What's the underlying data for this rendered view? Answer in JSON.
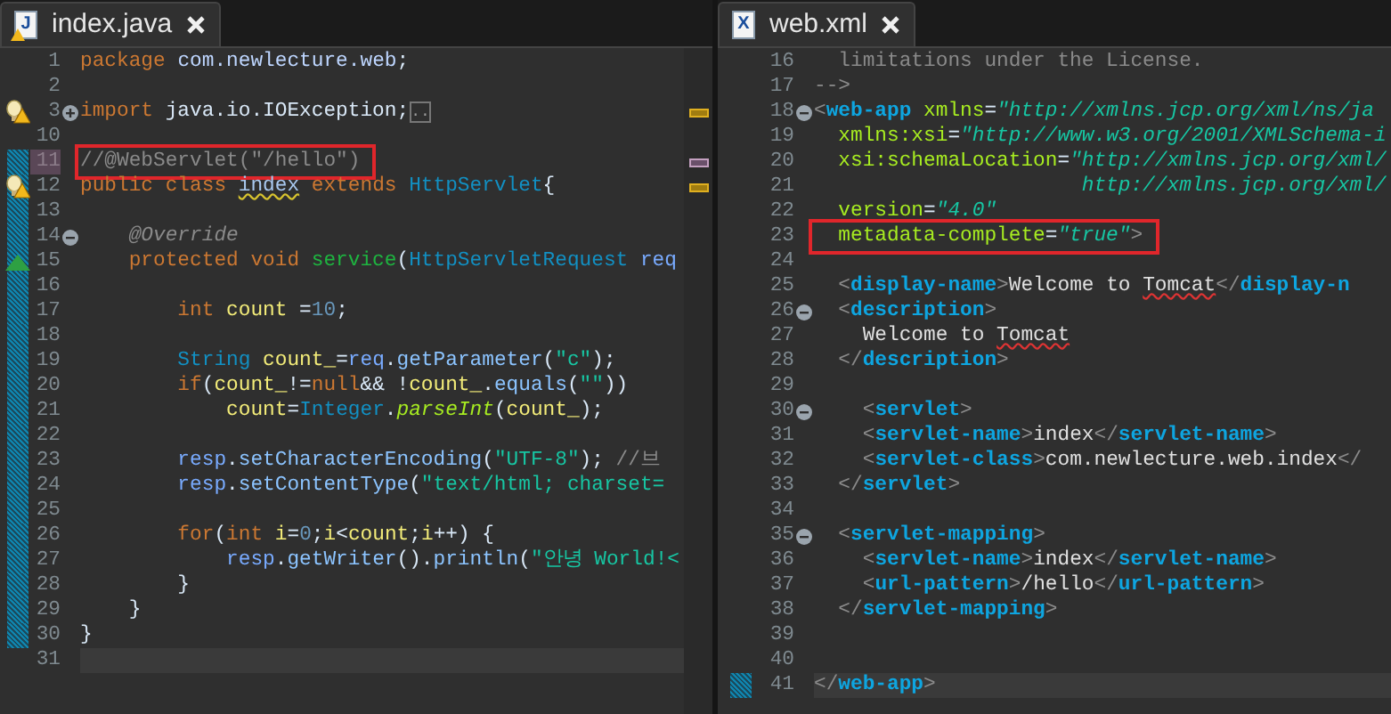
{
  "editors": [
    {
      "tab": {
        "icon": {
          "kind": "java",
          "letter": "J"
        },
        "title": "index.java"
      },
      "ruler": true,
      "lines": [
        {
          "number": "1",
          "changed": false,
          "boxed": false,
          "current": false,
          "tokens": [
            {
              "kind": "kw",
              "text": "package"
            },
            {
              "kind": "pkg",
              "text": " com.newlecture.web"
            },
            {
              "kind": "plain",
              "text": ";"
            }
          ]
        },
        {
          "number": "2",
          "changed": false,
          "boxed": false,
          "current": false
        },
        {
          "number": "3",
          "changed": false,
          "boxed": false,
          "current": false,
          "marker": {
            "kind": "warning"
          },
          "fold": {
            "kind": "plus"
          },
          "ruler_mark": {
            "kind": "warning"
          },
          "tokens": [
            {
              "kind": "kw",
              "text": "import"
            },
            {
              "kind": "plain",
              "text": " java.io.IOException;"
            },
            {
              "kind": "folded",
              "text": ".."
            }
          ]
        },
        {
          "number": "10",
          "changed": false,
          "boxed": false,
          "current": false
        },
        {
          "number": "11",
          "changed": true,
          "boxed": true,
          "current": false,
          "ruler_mark": {
            "kind": "task"
          },
          "tokens": [
            {
              "kind": "comment",
              "text": "//@WebServlet(\"/hello\")"
            }
          ]
        },
        {
          "number": "12",
          "changed": true,
          "boxed": false,
          "current": false,
          "marker": {
            "kind": "warning"
          },
          "ruler_mark": {
            "kind": "warning"
          },
          "tokens": [
            {
              "kind": "kw",
              "text": "public class "
            },
            {
              "kind": "warnident",
              "text": "index"
            },
            {
              "kind": "kw",
              "text": " extends "
            },
            {
              "kind": "type",
              "text": "HttpServlet"
            },
            {
              "kind": "plain",
              "text": "{"
            }
          ]
        },
        {
          "number": "13",
          "changed": true,
          "boxed": false,
          "current": false
        },
        {
          "number": "14",
          "changed": true,
          "boxed": false,
          "current": false,
          "fold": {
            "kind": "minus"
          },
          "tokens": [
            {
              "kind": "annot",
              "text": "    @Override"
            }
          ]
        },
        {
          "number": "15",
          "changed": true,
          "boxed": false,
          "current": false,
          "marker": {
            "kind": "override"
          },
          "tokens": [
            {
              "kind": "kw",
              "text": "    protected void "
            },
            {
              "kind": "method",
              "text": "service"
            },
            {
              "kind": "plain",
              "text": "("
            },
            {
              "kind": "type",
              "text": "HttpServletRequest"
            },
            {
              "kind": "param",
              "text": " req"
            }
          ]
        },
        {
          "number": "16",
          "changed": true,
          "boxed": false,
          "current": false
        },
        {
          "number": "17",
          "changed": true,
          "boxed": false,
          "current": false,
          "tokens": [
            {
              "kind": "kw",
              "text": "        int"
            },
            {
              "kind": "var",
              "text": " count"
            },
            {
              "kind": "plain",
              "text": " ="
            },
            {
              "kind": "num",
              "text": "10"
            },
            {
              "kind": "plain",
              "text": ";"
            }
          ]
        },
        {
          "number": "18",
          "changed": true,
          "boxed": false,
          "current": false
        },
        {
          "number": "19",
          "changed": true,
          "boxed": false,
          "current": false,
          "tokens": [
            {
              "kind": "type",
              "text": "        String"
            },
            {
              "kind": "var",
              "text": " count_"
            },
            {
              "kind": "plain",
              "text": "="
            },
            {
              "kind": "param",
              "text": "req"
            },
            {
              "kind": "plain",
              "text": "."
            },
            {
              "kind": "call",
              "text": "getParameter"
            },
            {
              "kind": "plain",
              "text": "("
            },
            {
              "kind": "str",
              "text": "\"c\""
            },
            {
              "kind": "plain",
              "text": ");"
            }
          ]
        },
        {
          "number": "20",
          "changed": true,
          "boxed": false,
          "current": false,
          "tokens": [
            {
              "kind": "kw",
              "text": "        if"
            },
            {
              "kind": "plain",
              "text": "("
            },
            {
              "kind": "var",
              "text": "count_"
            },
            {
              "kind": "plain",
              "text": "!="
            },
            {
              "kind": "kw",
              "text": "null"
            },
            {
              "kind": "plain",
              "text": "&& !"
            },
            {
              "kind": "var",
              "text": "count_"
            },
            {
              "kind": "plain",
              "text": "."
            },
            {
              "kind": "call",
              "text": "equals"
            },
            {
              "kind": "plain",
              "text": "("
            },
            {
              "kind": "str",
              "text": "\"\""
            },
            {
              "kind": "plain",
              "text": "))"
            }
          ]
        },
        {
          "number": "21",
          "changed": true,
          "boxed": false,
          "current": false,
          "tokens": [
            {
              "kind": "var",
              "text": "            count"
            },
            {
              "kind": "plain",
              "text": "="
            },
            {
              "kind": "type",
              "text": "Integer"
            },
            {
              "kind": "plain",
              "text": "."
            },
            {
              "kind": "static",
              "text": "parseInt"
            },
            {
              "kind": "plain",
              "text": "("
            },
            {
              "kind": "var",
              "text": "count_"
            },
            {
              "kind": "plain",
              "text": ");"
            }
          ]
        },
        {
          "number": "22",
          "changed": true,
          "boxed": false,
          "current": false
        },
        {
          "number": "23",
          "changed": true,
          "boxed": false,
          "current": false,
          "tokens": [
            {
              "kind": "param",
              "text": "        resp"
            },
            {
              "kind": "plain",
              "text": "."
            },
            {
              "kind": "call",
              "text": "setCharacterEncoding"
            },
            {
              "kind": "plain",
              "text": "("
            },
            {
              "kind": "str",
              "text": "\"UTF-8\""
            },
            {
              "kind": "plain",
              "text": ");"
            },
            {
              "kind": "comment",
              "text": " //브"
            }
          ]
        },
        {
          "number": "24",
          "changed": true,
          "boxed": false,
          "current": false,
          "tokens": [
            {
              "kind": "param",
              "text": "        resp"
            },
            {
              "kind": "plain",
              "text": "."
            },
            {
              "kind": "call",
              "text": "setContentType"
            },
            {
              "kind": "plain",
              "text": "("
            },
            {
              "kind": "str",
              "text": "\"text/html; charset="
            }
          ]
        },
        {
          "number": "25",
          "changed": true,
          "boxed": false,
          "current": false
        },
        {
          "number": "26",
          "changed": true,
          "boxed": false,
          "current": false,
          "tokens": [
            {
              "kind": "kw",
              "text": "        for"
            },
            {
              "kind": "plain",
              "text": "("
            },
            {
              "kind": "kw",
              "text": "int"
            },
            {
              "kind": "var",
              "text": " i"
            },
            {
              "kind": "plain",
              "text": "="
            },
            {
              "kind": "num",
              "text": "0"
            },
            {
              "kind": "plain",
              "text": ";"
            },
            {
              "kind": "var",
              "text": "i"
            },
            {
              "kind": "plain",
              "text": "<"
            },
            {
              "kind": "var",
              "text": "count"
            },
            {
              "kind": "plain",
              "text": ";"
            },
            {
              "kind": "var",
              "text": "i"
            },
            {
              "kind": "plain",
              "text": "++) {"
            }
          ]
        },
        {
          "number": "27",
          "changed": true,
          "boxed": false,
          "current": false,
          "tokens": [
            {
              "kind": "param",
              "text": "            resp"
            },
            {
              "kind": "plain",
              "text": "."
            },
            {
              "kind": "call",
              "text": "getWriter"
            },
            {
              "kind": "plain",
              "text": "()."
            },
            {
              "kind": "call",
              "text": "println"
            },
            {
              "kind": "plain",
              "text": "("
            },
            {
              "kind": "str",
              "text": "\"안녕 World!<"
            }
          ]
        },
        {
          "number": "28",
          "changed": true,
          "boxed": false,
          "current": false,
          "tokens": [
            {
              "kind": "plain",
              "text": "        }"
            }
          ]
        },
        {
          "number": "29",
          "changed": true,
          "boxed": false,
          "current": false,
          "tokens": [
            {
              "kind": "plain",
              "text": "    }"
            }
          ]
        },
        {
          "number": "30",
          "changed": true,
          "boxed": false,
          "current": false,
          "tokens": [
            {
              "kind": "plain",
              "text": "}"
            }
          ]
        },
        {
          "number": "31",
          "changed": false,
          "boxed": false,
          "current": true
        }
      ]
    },
    {
      "tab": {
        "icon": {
          "kind": "xml",
          "letter": "X"
        },
        "title": "web.xml"
      },
      "ruler": false,
      "lines": [
        {
          "number": "16",
          "changed": false,
          "boxed": false,
          "current": false,
          "tokens": [
            {
              "kind": "comment",
              "text": "  limitations under the License."
            }
          ]
        },
        {
          "number": "17",
          "changed": false,
          "boxed": false,
          "current": false,
          "tokens": [
            {
              "kind": "comment",
              "text": "-->"
            }
          ]
        },
        {
          "number": "18",
          "changed": false,
          "boxed": false,
          "current": false,
          "fold": {
            "kind": "minus"
          },
          "tokens": [
            {
              "kind": "bracket",
              "text": "<"
            },
            {
              "kind": "tag",
              "text": "web-app"
            },
            {
              "kind": "attr",
              "text": " xmlns"
            },
            {
              "kind": "plain",
              "text": "="
            },
            {
              "kind": "val",
              "text": "\"http://xmlns.jcp.org/xml/ns/ja"
            }
          ]
        },
        {
          "number": "19",
          "changed": false,
          "boxed": false,
          "current": false,
          "tokens": [
            {
              "kind": "attr",
              "text": "  xmlns:xsi"
            },
            {
              "kind": "plain",
              "text": "="
            },
            {
              "kind": "val",
              "text": "\"http://www.w3.org/2001/XMLSchema-i"
            }
          ]
        },
        {
          "number": "20",
          "changed": false,
          "boxed": false,
          "current": false,
          "tokens": [
            {
              "kind": "attr",
              "text": "  xsi:schemaLocation"
            },
            {
              "kind": "plain",
              "text": "="
            },
            {
              "kind": "val",
              "text": "\"http://xmlns.jcp.org/xml/"
            }
          ]
        },
        {
          "number": "21",
          "changed": false,
          "boxed": false,
          "current": false,
          "tokens": [
            {
              "kind": "val",
              "text": "                      http://xmlns.jcp.org/xml/"
            }
          ]
        },
        {
          "number": "22",
          "changed": false,
          "boxed": false,
          "current": false,
          "tokens": [
            {
              "kind": "attr",
              "text": "  version"
            },
            {
              "kind": "plain",
              "text": "="
            },
            {
              "kind": "val",
              "text": "\"4.0\""
            }
          ]
        },
        {
          "number": "23",
          "changed": false,
          "boxed": true,
          "current": false,
          "tokens": [
            {
              "kind": "attr",
              "text": "  metadata-complete"
            },
            {
              "kind": "plain",
              "text": "="
            },
            {
              "kind": "val",
              "text": "\"true\""
            },
            {
              "kind": "bracket",
              "text": ">"
            }
          ]
        },
        {
          "number": "24",
          "changed": false,
          "boxed": false,
          "current": false
        },
        {
          "number": "25",
          "changed": false,
          "boxed": false,
          "current": false,
          "tokens": [
            {
              "kind": "bracket",
              "text": "  <"
            },
            {
              "kind": "tag",
              "text": "display-name"
            },
            {
              "kind": "bracket",
              "text": ">"
            },
            {
              "kind": "text",
              "text": "Welcome to "
            },
            {
              "kind": "misspelled",
              "text": "Tomcat"
            },
            {
              "kind": "bracket",
              "text": "</"
            },
            {
              "kind": "tag",
              "text": "display-n"
            }
          ]
        },
        {
          "number": "26",
          "changed": false,
          "boxed": false,
          "current": false,
          "fold": {
            "kind": "minus"
          },
          "tokens": [
            {
              "kind": "bracket",
              "text": "  <"
            },
            {
              "kind": "tag",
              "text": "description"
            },
            {
              "kind": "bracket",
              "text": ">"
            }
          ]
        },
        {
          "number": "27",
          "changed": false,
          "boxed": false,
          "current": false,
          "tokens": [
            {
              "kind": "text",
              "text": "    Welcome to "
            },
            {
              "kind": "misspelled",
              "text": "Tomcat"
            }
          ]
        },
        {
          "number": "28",
          "changed": false,
          "boxed": false,
          "current": false,
          "tokens": [
            {
              "kind": "bracket",
              "text": "  </"
            },
            {
              "kind": "tag",
              "text": "description"
            },
            {
              "kind": "bracket",
              "text": ">"
            }
          ]
        },
        {
          "number": "29",
          "changed": false,
          "boxed": false,
          "current": false
        },
        {
          "number": "30",
          "changed": false,
          "boxed": false,
          "current": false,
          "fold": {
            "kind": "minus"
          },
          "tokens": [
            {
              "kind": "bracket",
              "text": "    <"
            },
            {
              "kind": "tag",
              "text": "servlet"
            },
            {
              "kind": "bracket",
              "text": ">"
            }
          ]
        },
        {
          "number": "31",
          "changed": false,
          "boxed": false,
          "current": false,
          "tokens": [
            {
              "kind": "bracket",
              "text": "    <"
            },
            {
              "kind": "tag",
              "text": "servlet-name"
            },
            {
              "kind": "bracket",
              "text": ">"
            },
            {
              "kind": "text",
              "text": "index"
            },
            {
              "kind": "bracket",
              "text": "</"
            },
            {
              "kind": "tag",
              "text": "servlet-name"
            },
            {
              "kind": "bracket",
              "text": ">"
            }
          ]
        },
        {
          "number": "32",
          "changed": false,
          "boxed": false,
          "current": false,
          "tokens": [
            {
              "kind": "bracket",
              "text": "    <"
            },
            {
              "kind": "tag",
              "text": "servlet-class"
            },
            {
              "kind": "bracket",
              "text": ">"
            },
            {
              "kind": "text",
              "text": "com.newlecture.web.index"
            },
            {
              "kind": "bracket",
              "text": "</"
            }
          ]
        },
        {
          "number": "33",
          "changed": false,
          "boxed": false,
          "current": false,
          "tokens": [
            {
              "kind": "bracket",
              "text": "  </"
            },
            {
              "kind": "tag",
              "text": "servlet"
            },
            {
              "kind": "bracket",
              "text": ">"
            }
          ]
        },
        {
          "number": "34",
          "changed": false,
          "boxed": false,
          "current": false
        },
        {
          "number": "35",
          "changed": false,
          "boxed": false,
          "current": false,
          "fold": {
            "kind": "minus"
          },
          "tokens": [
            {
              "kind": "bracket",
              "text": "  <"
            },
            {
              "kind": "tag",
              "text": "servlet-mapping"
            },
            {
              "kind": "bracket",
              "text": ">"
            }
          ]
        },
        {
          "number": "36",
          "changed": false,
          "boxed": false,
          "current": false,
          "tokens": [
            {
              "kind": "bracket",
              "text": "    <"
            },
            {
              "kind": "tag",
              "text": "servlet-name"
            },
            {
              "kind": "bracket",
              "text": ">"
            },
            {
              "kind": "text",
              "text": "index"
            },
            {
              "kind": "bracket",
              "text": "</"
            },
            {
              "kind": "tag",
              "text": "servlet-name"
            },
            {
              "kind": "bracket",
              "text": ">"
            }
          ]
        },
        {
          "number": "37",
          "changed": false,
          "boxed": false,
          "current": false,
          "tokens": [
            {
              "kind": "bracket",
              "text": "    <"
            },
            {
              "kind": "tag",
              "text": "url-pattern"
            },
            {
              "kind": "bracket",
              "text": ">"
            },
            {
              "kind": "text",
              "text": "/hello"
            },
            {
              "kind": "bracket",
              "text": "</"
            },
            {
              "kind": "tag",
              "text": "url-pattern"
            },
            {
              "kind": "bracket",
              "text": ">"
            }
          ]
        },
        {
          "number": "38",
          "changed": false,
          "boxed": false,
          "current": false,
          "tokens": [
            {
              "kind": "bracket",
              "text": "  </"
            },
            {
              "kind": "tag",
              "text": "servlet-mapping"
            },
            {
              "kind": "bracket",
              "text": ">"
            }
          ]
        },
        {
          "number": "39",
          "changed": false,
          "boxed": false,
          "current": false
        },
        {
          "number": "40",
          "changed": false,
          "boxed": false,
          "current": false
        },
        {
          "number": "41",
          "changed": true,
          "boxed": false,
          "current": true,
          "tokens": [
            {
              "kind": "bracket",
              "text": "</"
            },
            {
              "kind": "tag",
              "text": "web-app"
            },
            {
              "kind": "bracket",
              "text": ">"
            }
          ]
        }
      ]
    }
  ]
}
